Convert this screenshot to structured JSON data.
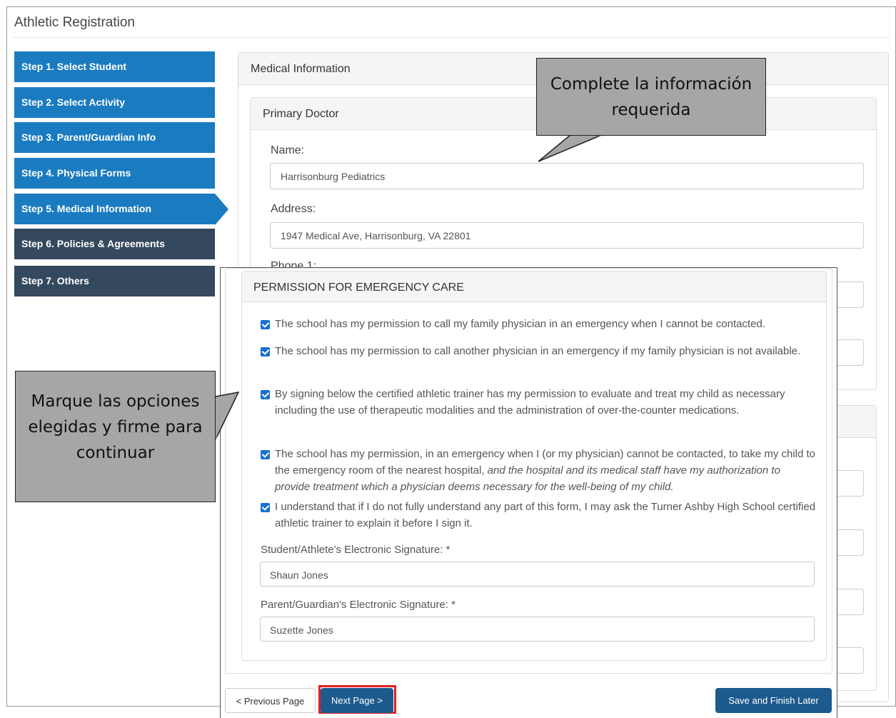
{
  "app": {
    "title": "Athletic Registration"
  },
  "steps": [
    {
      "label": "Step 1. Select Student"
    },
    {
      "label": "Step 2. Select Activity"
    },
    {
      "label": "Step 3. Parent/Guardian Info"
    },
    {
      "label": "Step 4. Physical Forms"
    },
    {
      "label": "Step 5. Medical Information"
    },
    {
      "label": "Step 6. Policies & Agreements"
    },
    {
      "label": "Step 7. Others"
    }
  ],
  "panel": {
    "title": "Medical Information"
  },
  "doctor": {
    "title": "Primary Doctor",
    "name_label": "Name:",
    "name_value": "Harrisonburg Pediatrics",
    "address_label": "Address:",
    "address_value": "1947 Medical Ave, Harrisonburg, VA 22801",
    "phone_label_partial": "Phone 1:"
  },
  "callouts": {
    "fill_required": "Complete la información requerida",
    "mark_and_sign": "Marque las opciones elegidas y firme para continuar"
  },
  "permission": {
    "title": "PERMISSION FOR EMERGENCY CARE",
    "items": [
      {
        "checked": true,
        "text": "The school has my permission to call my family physician in an emergency when I cannot be contacted."
      },
      {
        "checked": true,
        "text": "The school has my permission to call another physician in an emergency if my family physician is not available."
      },
      {
        "checked": true,
        "text": "By signing below the certified athletic trainer has my permission to evaluate and treat my child as necessary including the use of therapeutic modalities and the administration of over-the-counter medications."
      },
      {
        "checked": true,
        "text": "The school has my permission, in an emergency when I (or my physician) cannot be contacted, to take my child to the emergency room of the nearest hospital,",
        "italic": "and the hospital and its medical staff have my authorization to provide treatment which a physician deems necessary for the well-being of my child."
      },
      {
        "checked": true,
        "text": "I understand that if I do not fully understand any part of this form, I may ask the Turner Ashby High School certified athletic trainer to explain it before I sign it."
      }
    ],
    "student_sig_label": "Student/Athlete's Electronic Signature: *",
    "student_sig_value": "Shaun Jones",
    "parent_sig_label": "Parent/Guardian's Electronic Signature: *",
    "parent_sig_value": "Suzette Jones"
  },
  "buttons": {
    "prev": "< Previous Page",
    "next": "Next Page >",
    "save": "Save and Finish Later"
  },
  "colors": {
    "step_blue": "#1a7bc0",
    "step_dark": "#34495e",
    "button_primary": "#1d5a8e",
    "checkbox": "#1a6fd0",
    "highlight": "#e02020",
    "callout_bg": "#a6a6a6"
  }
}
